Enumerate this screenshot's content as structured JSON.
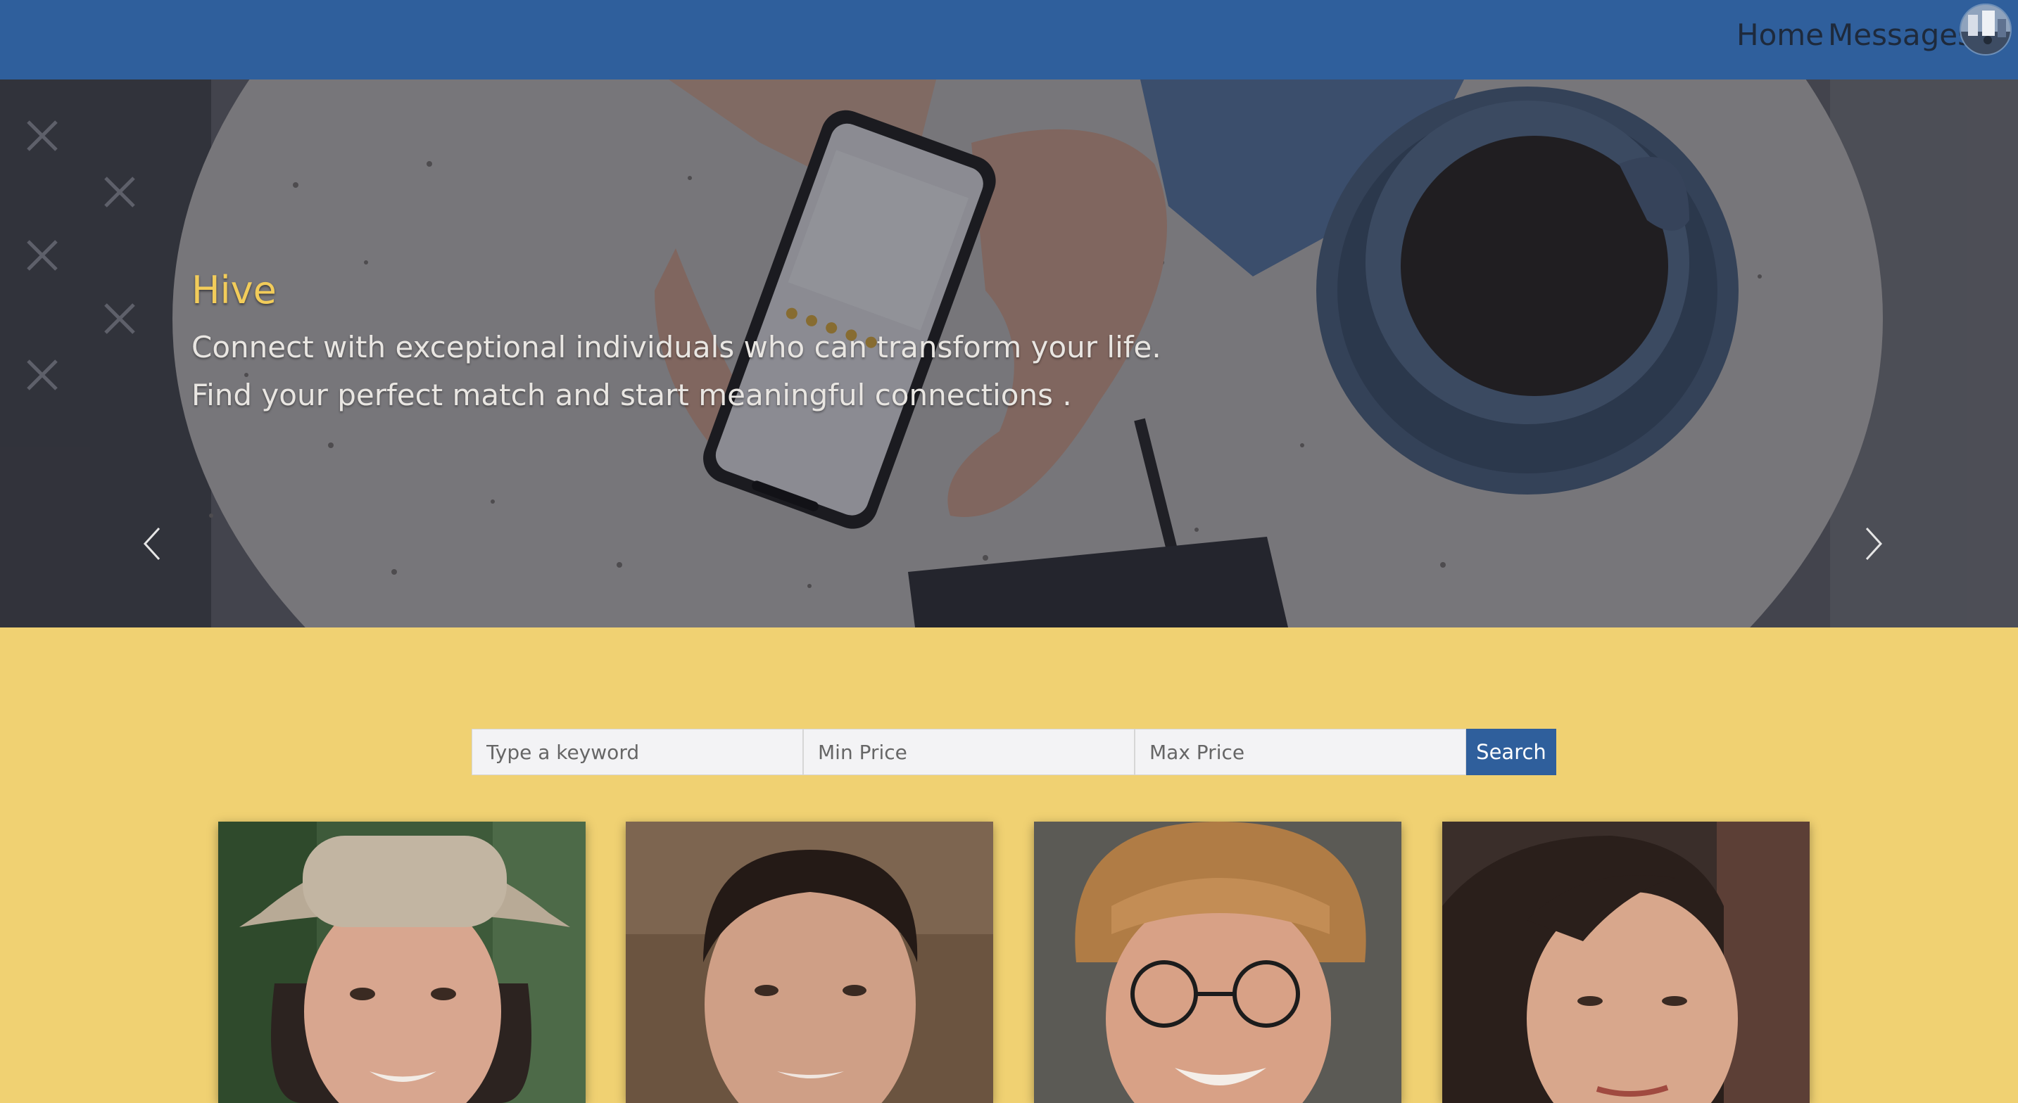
{
  "nav": {
    "home_label": "Home",
    "messages_label": "Messages",
    "avatar_icon": "user-avatar-icon"
  },
  "hero": {
    "title": "Hive",
    "line1": "Connect with exceptional individuals who can transform your life.",
    "line2": "Find your perfect match and start meaningful connections .",
    "prev_icon": "chevron-left-icon",
    "next_icon": "chevron-right-icon"
  },
  "search": {
    "keyword_placeholder": "Type a keyword",
    "min_price_placeholder": "Min Price",
    "max_price_placeholder": "Max Price",
    "button_label": "Search"
  },
  "colors": {
    "navbar": "#2f5f9c",
    "page_background": "#f0d172",
    "hero_title": "#f2cc5a",
    "search_button": "#2f5f9c"
  }
}
